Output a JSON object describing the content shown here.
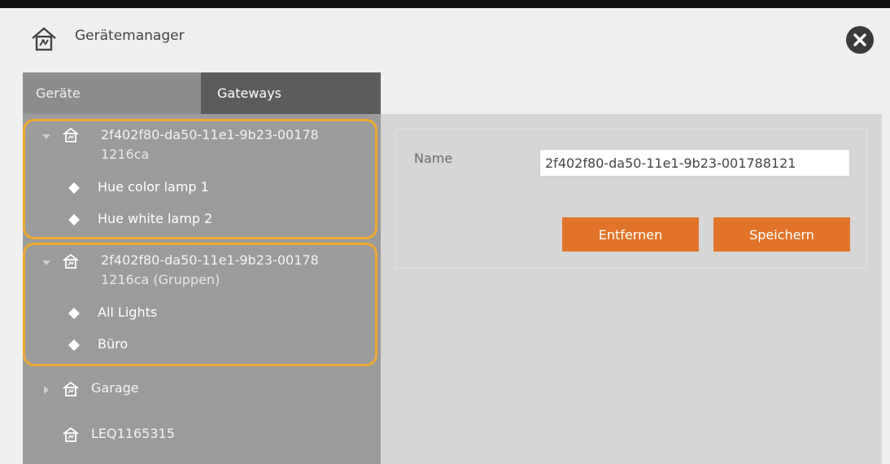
{
  "window": {
    "title": "Gerätemanager"
  },
  "tabs": [
    {
      "label": "Geräte",
      "active": false
    },
    {
      "label": "Gateways",
      "active": true
    }
  ],
  "tree": [
    {
      "name_line1": "2f402f80-da50-11e1-9b23-00178",
      "name_line2": "1216ca",
      "expanded": true,
      "lights": [
        "Hue color lamp 1",
        "Hue white lamp 2"
      ]
    },
    {
      "name_line1": "2f402f80-da50-11e1-9b23-00178",
      "name_line2": "1216ca (Gruppen)",
      "expanded": true,
      "lights": [
        "All Lights",
        "Büro"
      ]
    },
    {
      "name_line1": "Garage",
      "expanded": false
    },
    {
      "name_line1": "LEQ1165315"
    }
  ],
  "details": {
    "name_label": "Name",
    "name_value": "2f402f80-da50-11e1-9b23-001788121",
    "remove_label": "Entfernen",
    "save_label": "Speichern"
  },
  "colors": {
    "accent_orange": "#e2742a",
    "highlight_border": "#f0a830",
    "tab_active": "#5c5c5c",
    "panel_gray": "#9b9b9b"
  },
  "icons": {
    "title": "house-sensor-icon",
    "close": "close-icon",
    "gateway": "house-sensor-icon",
    "light": "light-bulb-icon",
    "expand": "chevron-down-icon",
    "collapse": "chevron-right-icon"
  }
}
